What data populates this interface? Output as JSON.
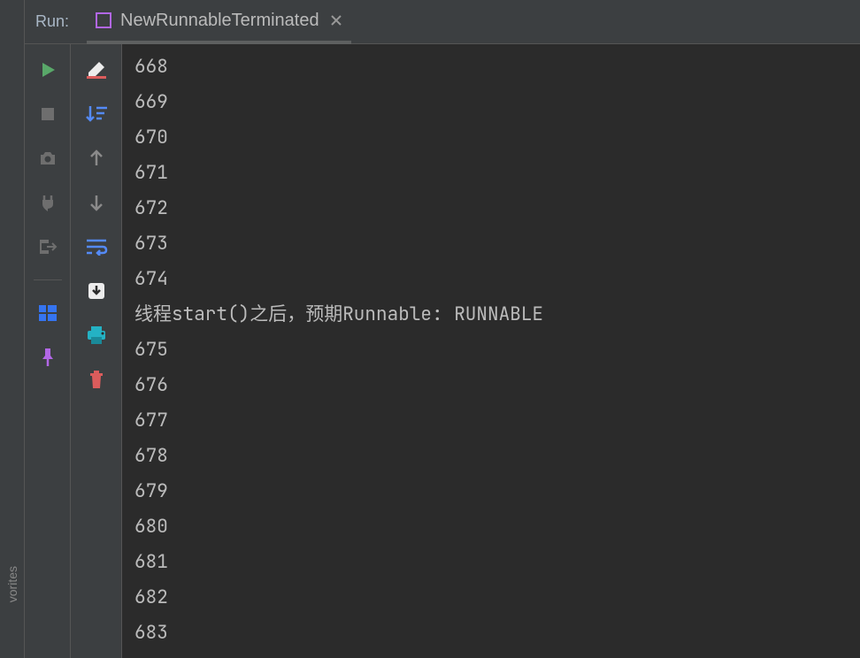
{
  "header": {
    "run_label": "Run:",
    "tab_label": "NewRunnableTerminated"
  },
  "sidebar": {
    "vertical_text": "vorites"
  },
  "console": {
    "lines": [
      "668",
      "669",
      "670",
      "671",
      "672",
      "673",
      "674",
      "线程start()之后，预期Runnable: RUNNABLE",
      "675",
      "676",
      "677",
      "678",
      "679",
      "680",
      "681",
      "682",
      "683"
    ]
  }
}
